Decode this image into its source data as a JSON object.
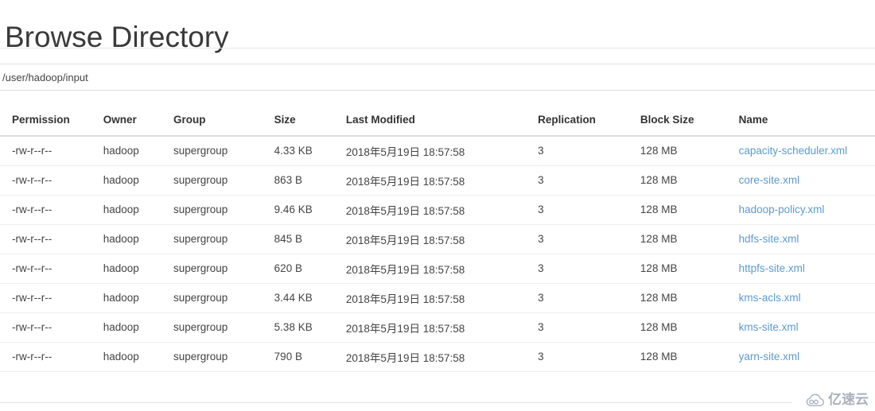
{
  "page": {
    "title": "Browse Directory"
  },
  "path_bar": {
    "path": "/user/hadoop/input"
  },
  "table": {
    "headers": {
      "permission": "Permission",
      "owner": "Owner",
      "group": "Group",
      "size": "Size",
      "last_modified": "Last Modified",
      "replication": "Replication",
      "block_size": "Block Size",
      "name": "Name"
    },
    "rows": [
      {
        "permission": "-rw-r--r--",
        "owner": "hadoop",
        "group": "supergroup",
        "size": "4.33 KB",
        "last_modified": "2018年5月19日 18:57:58",
        "replication": "3",
        "block_size": "128 MB",
        "name": "capacity-scheduler.xml"
      },
      {
        "permission": "-rw-r--r--",
        "owner": "hadoop",
        "group": "supergroup",
        "size": "863 B",
        "last_modified": "2018年5月19日 18:57:58",
        "replication": "3",
        "block_size": "128 MB",
        "name": "core-site.xml"
      },
      {
        "permission": "-rw-r--r--",
        "owner": "hadoop",
        "group": "supergroup",
        "size": "9.46 KB",
        "last_modified": "2018年5月19日 18:57:58",
        "replication": "3",
        "block_size": "128 MB",
        "name": "hadoop-policy.xml"
      },
      {
        "permission": "-rw-r--r--",
        "owner": "hadoop",
        "group": "supergroup",
        "size": "845 B",
        "last_modified": "2018年5月19日 18:57:58",
        "replication": "3",
        "block_size": "128 MB",
        "name": "hdfs-site.xml"
      },
      {
        "permission": "-rw-r--r--",
        "owner": "hadoop",
        "group": "supergroup",
        "size": "620 B",
        "last_modified": "2018年5月19日 18:57:58",
        "replication": "3",
        "block_size": "128 MB",
        "name": "httpfs-site.xml"
      },
      {
        "permission": "-rw-r--r--",
        "owner": "hadoop",
        "group": "supergroup",
        "size": "3.44 KB",
        "last_modified": "2018年5月19日 18:57:58",
        "replication": "3",
        "block_size": "128 MB",
        "name": "kms-acls.xml"
      },
      {
        "permission": "-rw-r--r--",
        "owner": "hadoop",
        "group": "supergroup",
        "size": "5.38 KB",
        "last_modified": "2018年5月19日 18:57:58",
        "replication": "3",
        "block_size": "128 MB",
        "name": "kms-site.xml"
      },
      {
        "permission": "-rw-r--r--",
        "owner": "hadoop",
        "group": "supergroup",
        "size": "790 B",
        "last_modified": "2018年5月19日 18:57:58",
        "replication": "3",
        "block_size": "128 MB",
        "name": "yarn-site.xml"
      }
    ]
  },
  "watermark": {
    "text": "亿速云",
    "icon": "cloud-icon",
    "color": "#9aa4b5"
  },
  "colors": {
    "link": "#5b9bd2",
    "text": "#444444",
    "heading": "#3a3a3a",
    "border": "#dddddd",
    "row_border": "#eeeeee"
  }
}
